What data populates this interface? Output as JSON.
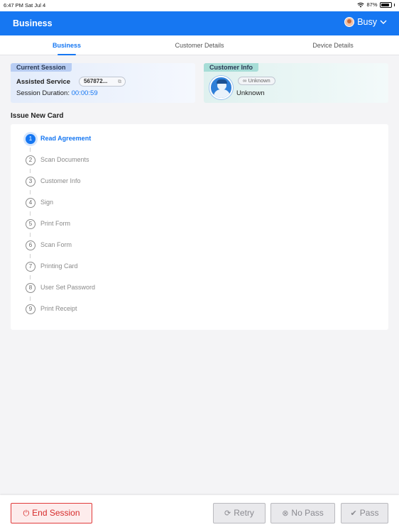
{
  "statusbar": {
    "time": "6:47 PM",
    "date": "Sat Jul 4",
    "battery": "87%",
    "battery_level": 0.87
  },
  "header": {
    "title": "Business",
    "status": "Busy"
  },
  "tabs": [
    {
      "label": "Business",
      "active": true
    },
    {
      "label": "Customer Details",
      "active": false
    },
    {
      "label": "Device Details",
      "active": false
    }
  ],
  "session": {
    "label": "Current Session",
    "service": "Assisted Service",
    "session_id": "567872...",
    "duration_label": "Session Duration:",
    "duration_value": "00:00:59"
  },
  "customer": {
    "label": "Customer Info",
    "badge": "Unknown",
    "name": "Unknown"
  },
  "issue": {
    "title": "Issue New Card",
    "steps": [
      {
        "num": "1",
        "label": "Read Agreement",
        "active": true
      },
      {
        "num": "2",
        "label": "Scan Documents"
      },
      {
        "num": "3",
        "label": "Customer Info"
      },
      {
        "num": "4",
        "label": "Sign"
      },
      {
        "num": "5",
        "label": "Print Form"
      },
      {
        "num": "6",
        "label": "Scan Form"
      },
      {
        "num": "7",
        "label": "Printing Card"
      },
      {
        "num": "8",
        "label": "User Set Password"
      },
      {
        "num": "9",
        "label": "Print Receipt"
      }
    ]
  },
  "actions": {
    "end_session": "End Session",
    "retry": "Retry",
    "no_pass": "No Pass",
    "pass": "Pass"
  },
  "colors": {
    "primary": "#1677f2",
    "danger": "#d62b2b"
  }
}
